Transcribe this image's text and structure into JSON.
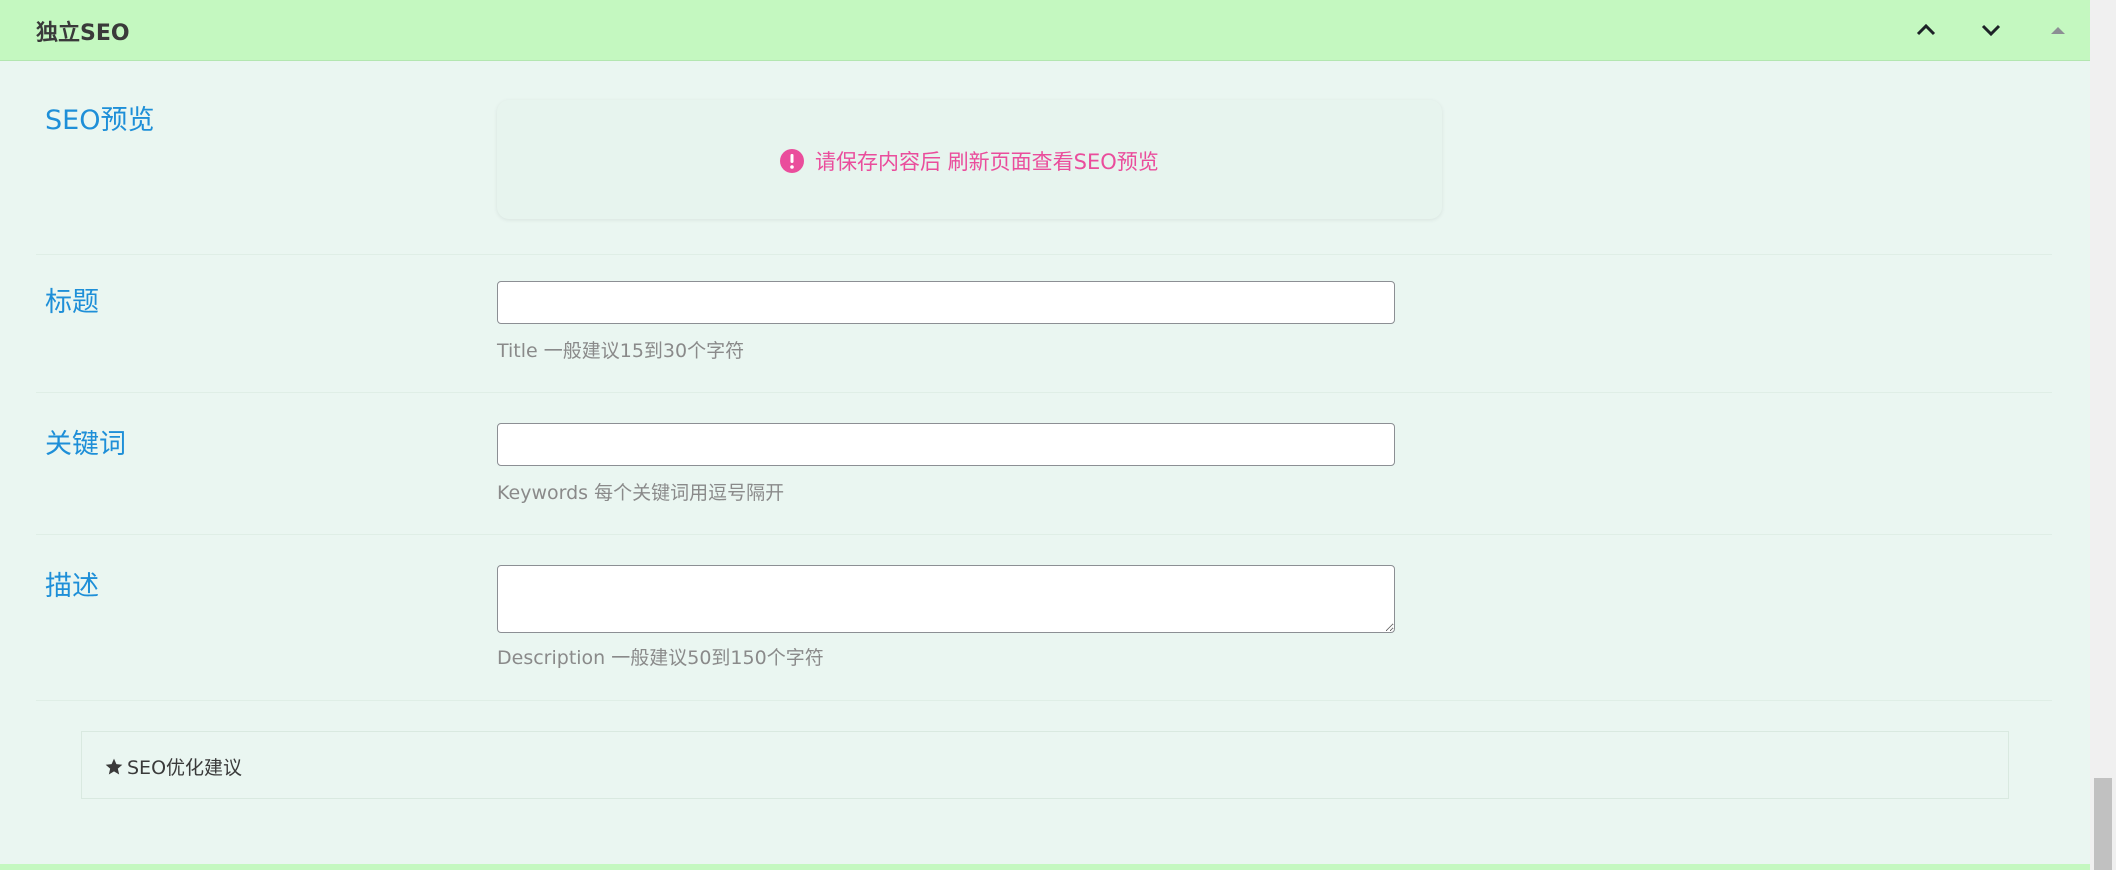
{
  "panel": {
    "title": "独立SEO",
    "move_up_label": "move up",
    "move_down_label": "move down",
    "toggle_label": "toggle panel"
  },
  "preview": {
    "label": "SEO预览",
    "message": "请保存内容后 刷新页面查看SEO预览"
  },
  "title_field": {
    "label": "标题",
    "value": "",
    "hint": "Title 一般建议15到30个字符"
  },
  "keywords_field": {
    "label": "关键词",
    "value": "",
    "hint": "Keywords 每个关键词用逗号隔开"
  },
  "description_field": {
    "label": "描述",
    "value": "",
    "hint": "Description 一般建议50到150个字符"
  },
  "tips": {
    "label": "SEO优化建议"
  },
  "colors": {
    "header_bg": "#c4f8c0",
    "panel_bg": "#eaf6f1",
    "label_blue": "#1e8fd8",
    "warning_pink": "#ea4d9c"
  },
  "icons": {
    "move_up": "chevron-up-icon",
    "move_down": "chevron-down-icon",
    "toggle": "triangle-up-icon",
    "alert": "alert-circle-icon",
    "star": "star-icon"
  }
}
